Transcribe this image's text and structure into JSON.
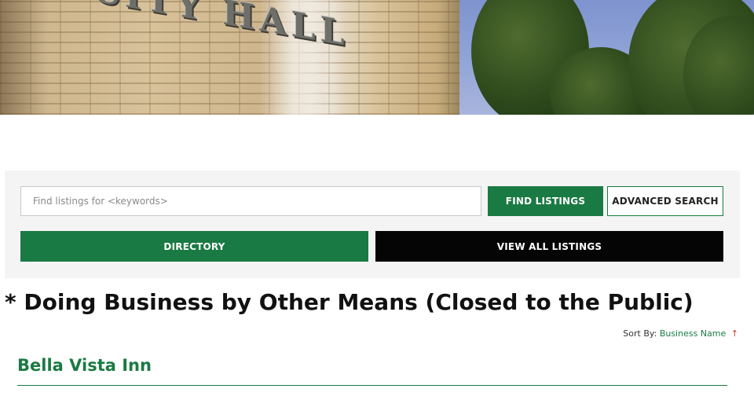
{
  "hero": {
    "sign_text": "CITY HALL"
  },
  "search": {
    "placeholder": "Find listings for <keywords>",
    "find_label": "FIND LISTINGS",
    "advanced_label": "ADVANCED SEARCH",
    "directory_label": "DIRECTORY",
    "view_all_label": "VIEW ALL LISTINGS"
  },
  "page": {
    "title": "* Doing Business by Other Means (Closed to the Public)"
  },
  "sort": {
    "label": "Sort By:",
    "value": "Business Name",
    "arrow": "↑"
  },
  "listings": [
    {
      "name": "Bella Vista Inn"
    }
  ],
  "colors": {
    "brand_green": "#1a7a43",
    "dark_button": "#050505",
    "panel_bg": "#f4f4f4"
  }
}
